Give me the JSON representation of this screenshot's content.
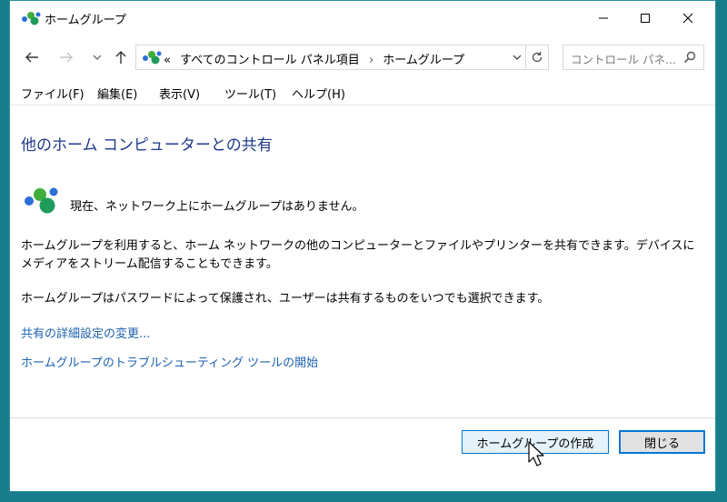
{
  "window": {
    "title": "ホームグループ",
    "controls": {
      "minimize": "minimize-icon",
      "maximize": "maximize-icon",
      "close": "close-icon"
    }
  },
  "nav": {
    "back_icon": "arrow-left-icon",
    "forward_icon": "arrow-right-icon",
    "recent_icon": "chevron-down-icon",
    "up_icon": "arrow-up-icon",
    "address": {
      "prefix": "«",
      "segments": [
        "すべてのコントロール パネル項目",
        "ホームグループ"
      ],
      "separator": "›"
    },
    "search_placeholder": "コントロール パネ..."
  },
  "menu": {
    "items": [
      "ファイル(F)",
      "編集(E)",
      "表示(V)",
      "ツール(T)",
      "ヘルプ(H)"
    ]
  },
  "content": {
    "heading": "他のホーム コンピューターとの共有",
    "no_homegroup": "現在、ネットワーク上にホームグループはありません。",
    "paragraph1": "ホームグループを利用すると、ホーム ネットワークの他のコンピューターとファイルやプリンターを共有できます。デバイスにメディアをストリーム配信することもできます。",
    "paragraph2": "ホームグループはパスワードによって保護され、ユーザーは共有するものをいつでも選択できます。",
    "link_advanced": "共有の詳細設定の変更...",
    "link_troubleshoot": "ホームグループのトラブルシューティング ツールの開始"
  },
  "footer": {
    "create_button": "ホームグループの作成",
    "close_button": "閉じる"
  },
  "colors": {
    "desktop": "#1a7d8c",
    "heading": "#1e3a8a",
    "link": "#1c61b0",
    "accent": "#0078d7"
  }
}
